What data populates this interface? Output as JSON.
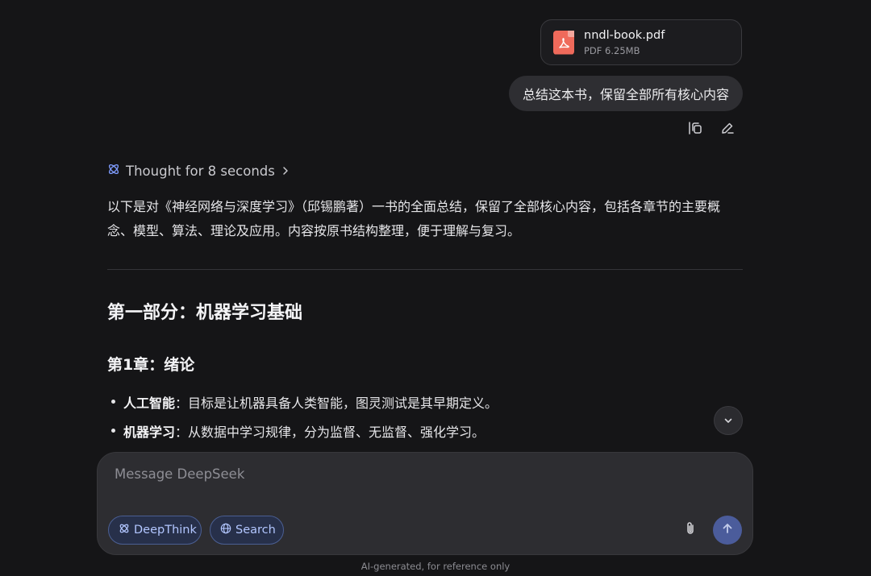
{
  "attachment": {
    "filename": "nndl-book.pdf",
    "meta": "PDF 6.25MB",
    "icon": "pdf-file-icon",
    "icon_color": "#ef6a5b"
  },
  "user_message": {
    "text": "总结这本书，保留全部所有核心内容",
    "actions": [
      "copy-icon",
      "edit-icon"
    ]
  },
  "assistant": {
    "thought_label": "Thought for 8 seconds",
    "intro": "以下是对《神经网络与深度学习》（邱锡鹏著）一书的全面总结，保留了全部核心内容，包括各章节的主要概念、模型、算法、理论及应用。内容按原书结构整理，便于理解与复习。",
    "section_title": "第一部分：机器学习基础",
    "chapter_title": "第1章：绪论",
    "bullets": [
      {
        "term": "人工智能",
        "text": "：目标是让机器具备人类智能，图灵测试是其早期定义。"
      },
      {
        "term": "机器学习",
        "text": "：从数据中学习规律，分为监督、无监督、强化学习。"
      }
    ]
  },
  "composer": {
    "placeholder": "Message DeepSeek",
    "deepthink_label": "DeepThink",
    "search_label": "Search",
    "accent_color": "#4b5c9b"
  },
  "disclaimer": "AI-generated, for reference only"
}
